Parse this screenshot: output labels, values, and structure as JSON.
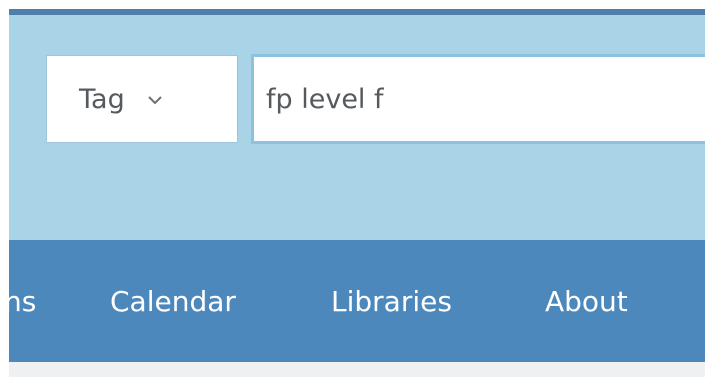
{
  "search": {
    "type_label": "Tag",
    "type_icon": "chevron-down-icon",
    "query": "fp level f"
  },
  "nav": {
    "items": [
      {
        "label": "ns"
      },
      {
        "label": "Calendar"
      },
      {
        "label": "Libraries"
      },
      {
        "label": "About"
      }
    ]
  },
  "colors": {
    "search_band": "#a9d4e8",
    "nav_band": "#4d88bc",
    "top_rule": "#4e7eaa",
    "input_border": "#8ec1de",
    "text_dark": "#555a5f",
    "nav_text": "#ffffff"
  }
}
